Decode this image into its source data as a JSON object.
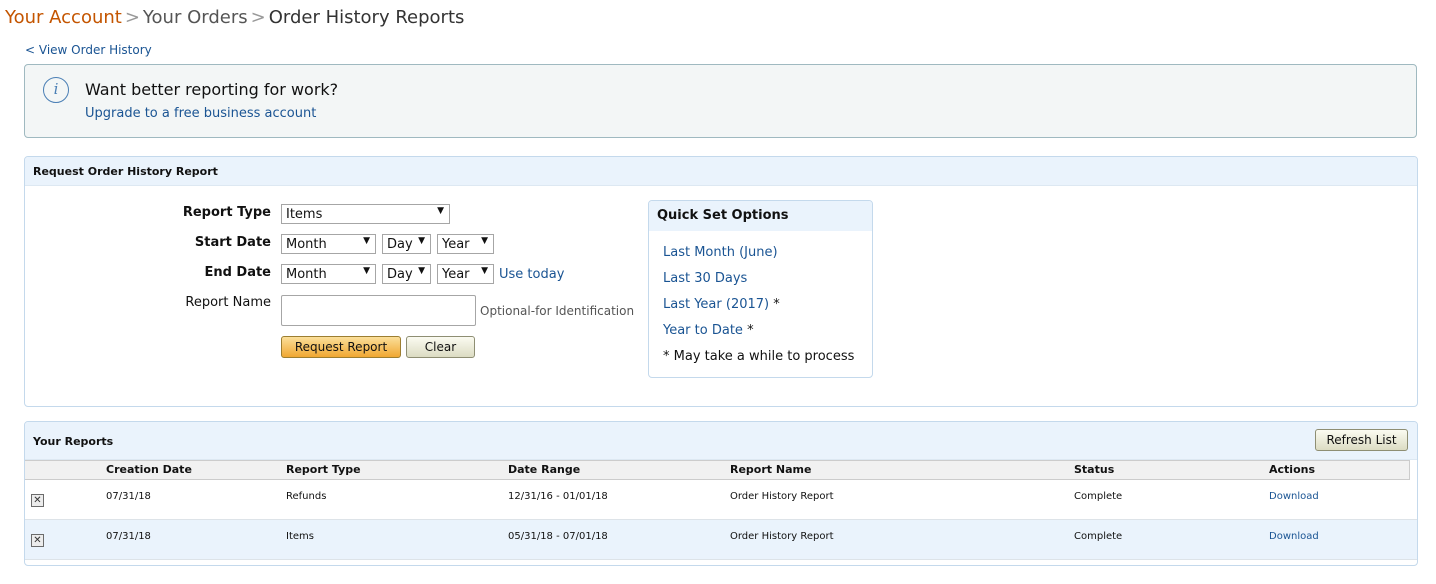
{
  "breadcrumb": {
    "your_account": "Your Account",
    "sep1": ">",
    "your_orders": "Your Orders",
    "sep2": ">",
    "current": "Order History Reports"
  },
  "back_link": "< View Order History",
  "upsell": {
    "icon": "info-icon",
    "icon_glyph": "i",
    "title": "Want better reporting for work?",
    "link": "Upgrade to a free business account"
  },
  "request_panel": {
    "title": "Request Order History Report",
    "report_type": {
      "label": "Report Type",
      "value": "Items"
    },
    "start_date": {
      "label": "Start Date",
      "month": "Month",
      "day": "Day",
      "year": "Year"
    },
    "end_date": {
      "label": "End Date",
      "month": "Month",
      "day": "Day",
      "year": "Year",
      "use_today": "Use today"
    },
    "report_name": {
      "label": "Report Name",
      "value": "",
      "hint": "Optional-for Identification"
    },
    "request_button": "Request Report",
    "clear_button": "Clear",
    "quick_set": {
      "title": "Quick Set Options",
      "items": [
        {
          "label": "Last Month (June)",
          "star": ""
        },
        {
          "label": "Last 30 Days",
          "star": ""
        },
        {
          "label": "Last Year (2017)",
          "star": "*"
        },
        {
          "label": "Year to Date",
          "star": "*"
        }
      ],
      "note": "* May take a while to process"
    }
  },
  "reports_panel": {
    "title": "Your Reports",
    "refresh_button": "Refresh List",
    "columns": [
      "Creation Date",
      "Report Type",
      "Date Range",
      "Report Name",
      "Status",
      "Actions"
    ],
    "rows": [
      {
        "creation_date": "07/31/18",
        "report_type": "Refunds",
        "date_range": "12/31/16 - 01/01/18",
        "report_name": "Order History Report",
        "status": "Complete",
        "action": "Download"
      },
      {
        "creation_date": "07/31/18",
        "report_type": "Items",
        "date_range": "05/31/18 - 07/01/18",
        "report_name": "Order History Report",
        "status": "Complete",
        "action": "Download"
      }
    ],
    "delete_glyph": "✕"
  },
  "colors": {
    "link": "#1a5493",
    "breadcrumb_accent": "#c45500",
    "panel_header": "#eaf3fc",
    "primary_button": "#f0a732"
  }
}
